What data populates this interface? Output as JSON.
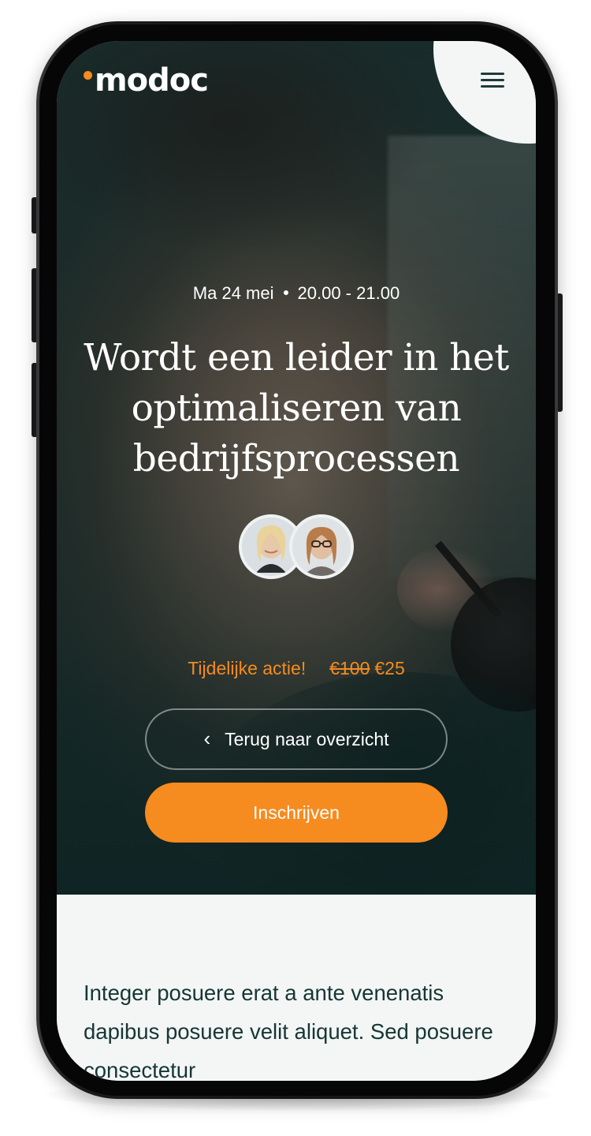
{
  "header": {
    "logo_text": "modoc",
    "menu_icon": "hamburger-menu-icon"
  },
  "event": {
    "date": "Ma 24 mei",
    "time": "20.00 - 21.00",
    "title": "Wordt een leider in het optimaliseren van bedrijfsprocessen",
    "speakers": [
      {
        "icon": "speaker-avatar-1"
      },
      {
        "icon": "speaker-avatar-2"
      }
    ]
  },
  "pricing": {
    "promo_label": "Tijdelijke actie!",
    "old_price": "€100",
    "new_price": "€25"
  },
  "actions": {
    "back_label": "Terug naar overzicht",
    "signup_label": "Inschrijven"
  },
  "content": {
    "intro": "Integer posuere erat a ante venenatis dapibus posuere velit aliquet. Sed posuere consectetur"
  },
  "colors": {
    "accent": "#f68b1f",
    "dark_teal": "#163634",
    "background": "#f3f6f5"
  }
}
